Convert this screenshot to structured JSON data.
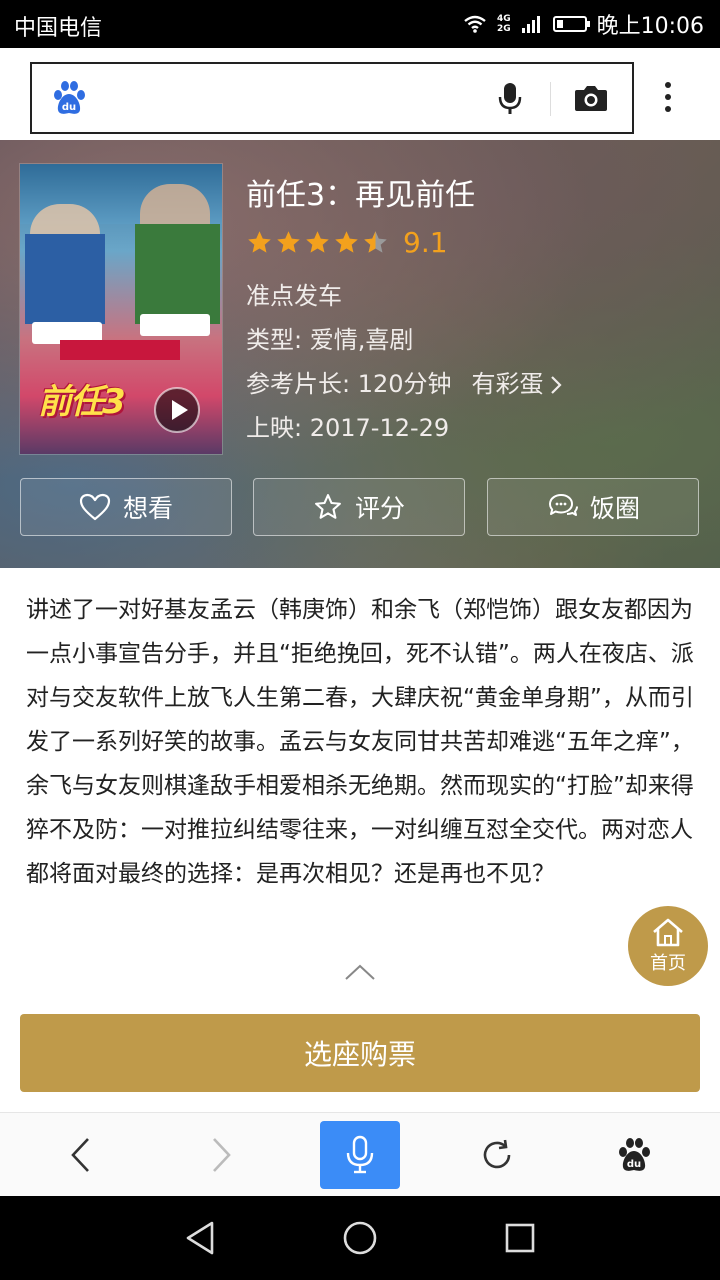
{
  "status_bar": {
    "carrier": "中国电信",
    "network_top": "4G",
    "network_bottom": "2G",
    "time": "晚上10:06"
  },
  "search": {
    "value": "",
    "placeholder": ""
  },
  "movie": {
    "title": "前任3：再见前任",
    "rating_stars": 4.5,
    "rating_value": "9.1",
    "tagline": "准点发车",
    "genre": "类型: 爱情,喜剧",
    "duration": "参考片长: 120分钟",
    "easter_egg": "有彩蛋",
    "release": "上映: 2017-12-29",
    "poster_title": "前任3"
  },
  "actions": {
    "want": "想看",
    "rate": "评分",
    "circle": "饭圈"
  },
  "synopsis": "讲述了一对好基友孟云（韩庚饰）和余飞（郑恺饰）跟女友都因为一点小事宣告分手，并且“拒绝挽回，死不认错”。两人在夜店、派对与交友软件上放飞人生第二春，大肆庆祝“黄金单身期”，从而引发了一系列好笑的故事。孟云与女友同甘共苦却难逃“五年之痒”，余飞与女友则棋逢敌手相爱相杀无绝期。然而现实的“打脸”却来得猝不及防：一对推拉纠结零往来，一对纠缠互怼全交代。两对恋人都将面对最终的选择：是再次相见？还是再也不见？",
  "home_fab": "首页",
  "buy_button": "选座购票",
  "colors": {
    "accent_gold": "#bf9a4a",
    "rating_orange": "#f3a11d",
    "voice_blue": "#3b8cf7"
  }
}
